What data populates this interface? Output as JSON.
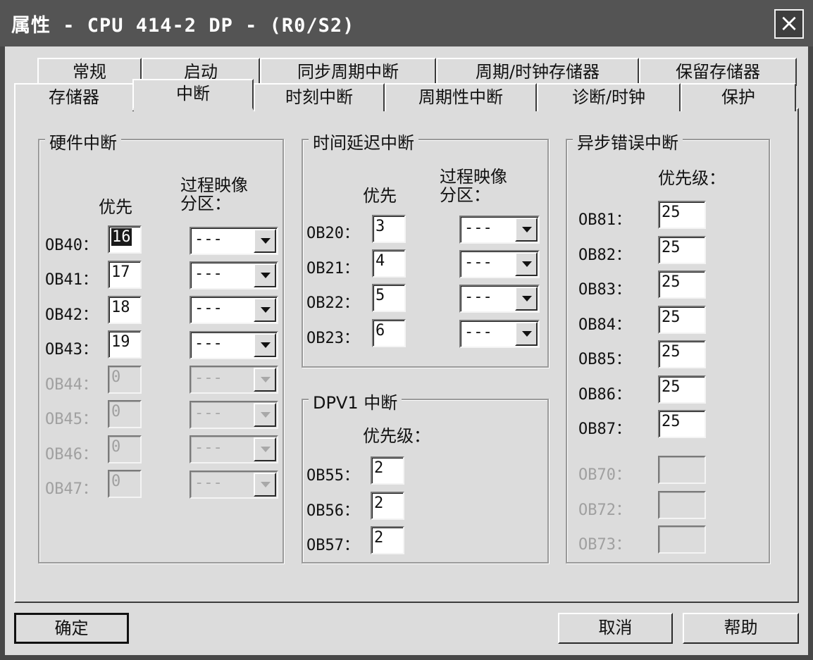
{
  "window": {
    "title": "属性 - CPU 414-2 DP - (R0/S2)",
    "close_icon": "×"
  },
  "tabs_back": [
    "常规",
    "启动",
    "同步周期中断",
    "周期/时钟存储器",
    "保留存储器"
  ],
  "tabs_front": [
    "存储器",
    "中断",
    "时刻中断",
    "周期性中断",
    "诊断/时钟",
    "保护"
  ],
  "active_tab": "中断",
  "hardware": {
    "title": "硬件中断",
    "col_priority": "优先",
    "col_image_1": "过程映像",
    "col_image_2": "分区：",
    "rows": [
      {
        "label": "OB40：",
        "value": "16",
        "combo": "---"
      },
      {
        "label": "OB41：",
        "value": "17",
        "combo": "---"
      },
      {
        "label": "OB42：",
        "value": "18",
        "combo": "---"
      },
      {
        "label": "OB43：",
        "value": "19",
        "combo": "---"
      },
      {
        "label": "OB44：",
        "value": "0",
        "combo": "---"
      },
      {
        "label": "OB45：",
        "value": "0",
        "combo": "---"
      },
      {
        "label": "OB46：",
        "value": "0",
        "combo": "---"
      },
      {
        "label": "OB47：",
        "value": "0",
        "combo": "---"
      }
    ]
  },
  "delay": {
    "title": "时间延迟中断",
    "col_priority": "优先",
    "col_image_1": "过程映像",
    "col_image_2": "分区：",
    "rows": [
      {
        "label": "OB20：",
        "value": "3",
        "combo": "---"
      },
      {
        "label": "OB21：",
        "value": "4",
        "combo": "---"
      },
      {
        "label": "OB22：",
        "value": "5",
        "combo": "---"
      },
      {
        "label": "OB23：",
        "value": "6",
        "combo": "---"
      }
    ]
  },
  "dpv1": {
    "title": "DPV1 中断",
    "col_priority": "优先级：",
    "rows": [
      {
        "label": "OB55：",
        "value": "2"
      },
      {
        "label": "OB56：",
        "value": "2"
      },
      {
        "label": "OB57：",
        "value": "2"
      }
    ]
  },
  "async": {
    "title": "异步错误中断",
    "col_priority": "优先级：",
    "rows": [
      {
        "label": "OB81：",
        "value": "25"
      },
      {
        "label": "OB82：",
        "value": "25"
      },
      {
        "label": "OB83：",
        "value": "25"
      },
      {
        "label": "OB84：",
        "value": "25"
      },
      {
        "label": "OB85：",
        "value": "25"
      },
      {
        "label": "OB86：",
        "value": "25"
      },
      {
        "label": "OB87：",
        "value": "25"
      },
      {
        "label": "OB70：",
        "value": ""
      },
      {
        "label": "OB72：",
        "value": ""
      },
      {
        "label": "OB73：",
        "value": ""
      }
    ]
  },
  "buttons": {
    "ok": "确定",
    "cancel": "取消",
    "help": "帮助"
  },
  "colors": {
    "titlebar": "#545454",
    "face": "#dcdcdc",
    "disabled_text": "#a0a0a0"
  }
}
